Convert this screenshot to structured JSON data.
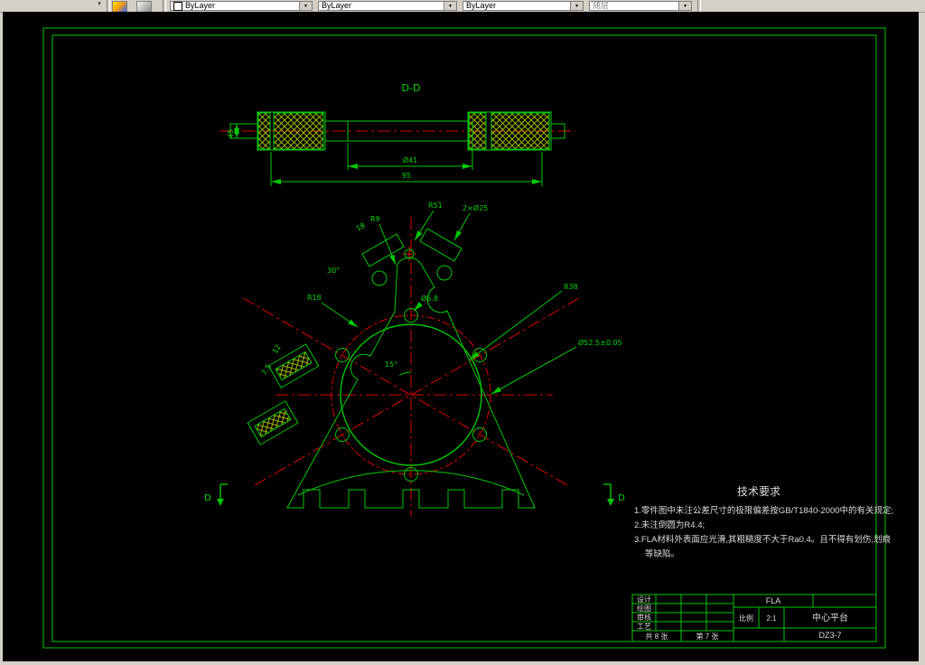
{
  "toolbar": {
    "color": "ByLayer",
    "linetype": "ByLayer",
    "lineweight": "ByLayer",
    "plotstyle": "随层"
  },
  "drawing": {
    "section_title": "D-D",
    "cut_label_left": "D",
    "cut_label_right": "D",
    "dims": {
      "sec_left": "45",
      "sec_mid": "Ø41",
      "sec_total": "95",
      "r51": "R51",
      "holes2": "2×Ø25",
      "r9": "R9",
      "len18": "18",
      "ang30": "30°",
      "r18": "R18",
      "ang15": "15°",
      "hole_d": "Ø6.8",
      "r38": "R38",
      "bolt": "Ø52.5±0.05",
      "d12": "12",
      "d75": "7.5"
    },
    "tech": {
      "title": "技术要求",
      "l1": "1.零件图中未注公差尺寸的极限偏差按GB/T1840-2000中的有关规定;",
      "l2": "2.未注倒圆为R4.4;",
      "l3": "3.FLA材料外表面应光滑,其粗糙度不大于Ra0.4。且不得有划伤,划痕",
      "l4": "等缺陷。"
    },
    "titleblock": {
      "r1": "设计",
      "r2": "绘图",
      "r3": "审核",
      "r4": "工艺",
      "sheets": "共 8 张",
      "sheet_no": "第 7 张",
      "scale_label": "比例",
      "scale": "2:1",
      "code": "FLA",
      "part": "中心平台",
      "dwg": "DZ3-7"
    }
  }
}
